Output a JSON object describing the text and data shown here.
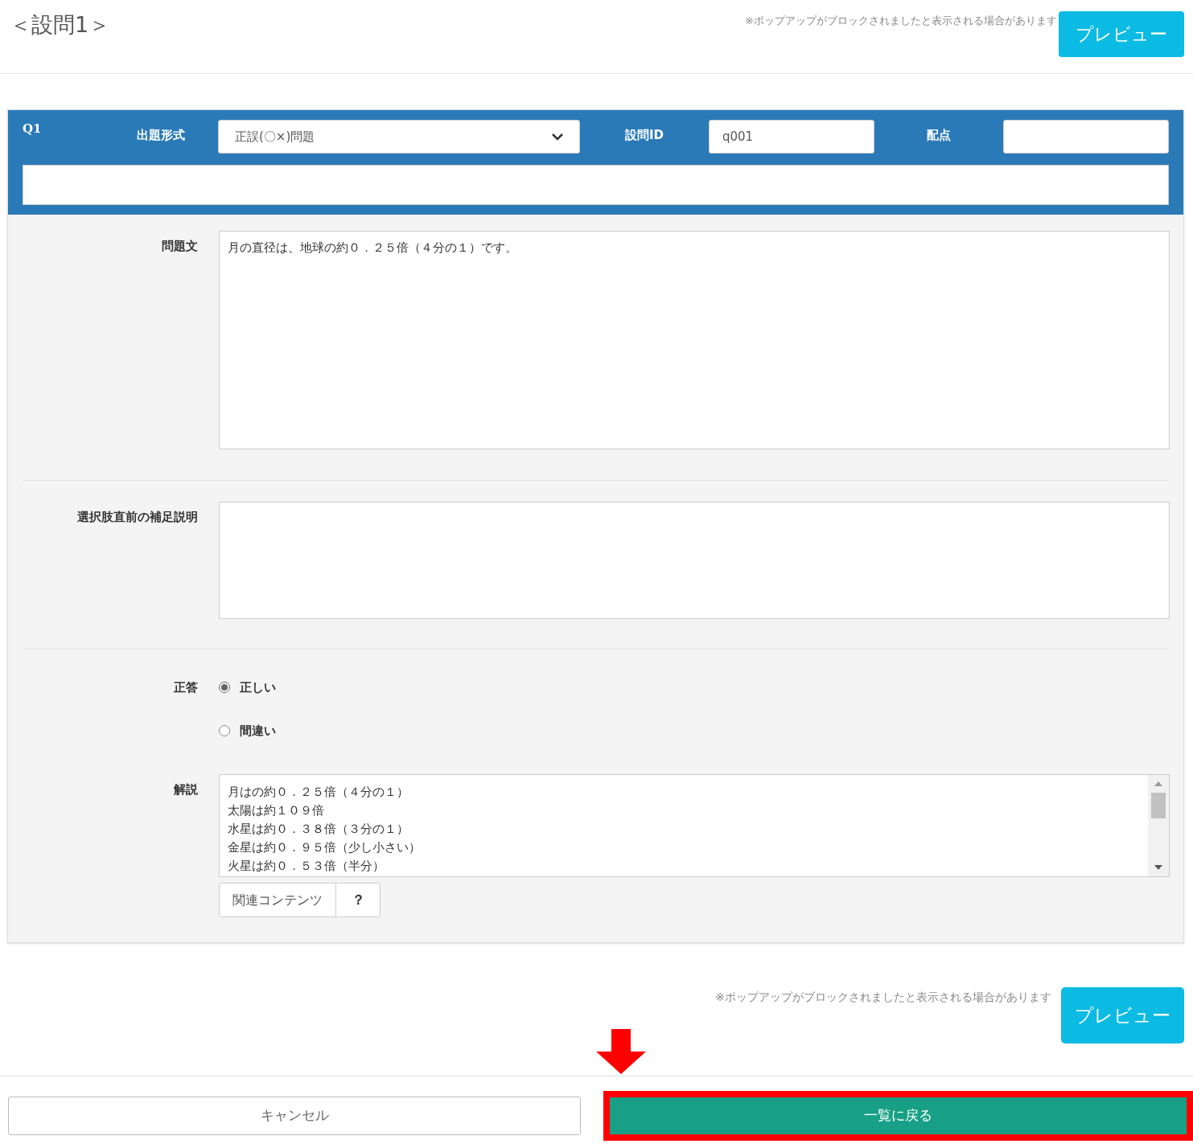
{
  "title": "＜設問1＞",
  "top_note": "※ポップアップがブロックされましたと表示される場合があります",
  "top_preview": "プレビュー",
  "question": {
    "number": "Q1",
    "format_label": "出題形式",
    "format_value": "正誤(〇×)問題",
    "id_label": "設問ID",
    "id_value": "q001",
    "points_label": "配点"
  },
  "body_label": "問題文",
  "body_value": "月の直径は、地球の約０．２５倍（４分の１）です。",
  "supplement_label": "選択肢直前の補足説明",
  "answer_label": "正答",
  "answers": [
    {
      "label": "正しい",
      "selected": true
    },
    {
      "label": "間違い",
      "selected": false
    }
  ],
  "explanation_label": "解説",
  "explanation_lines": [
    "月はの約０．２５倍（４分の１）",
    "太陽は約１０９倍",
    "水星は約０．３８倍（３分の１）",
    "金星は約０．９５倍（少し小さい）",
    "火星は約０．５３倍（半分）"
  ],
  "related_button": "関連コンテンツ",
  "help_button": "？",
  "bottom_note": "※ポップアップがブロックされましたと表示される場合があります",
  "bottom_preview": "プレビュー",
  "cancel_button": "キャンセル",
  "back_button": "一覧に戻る"
}
